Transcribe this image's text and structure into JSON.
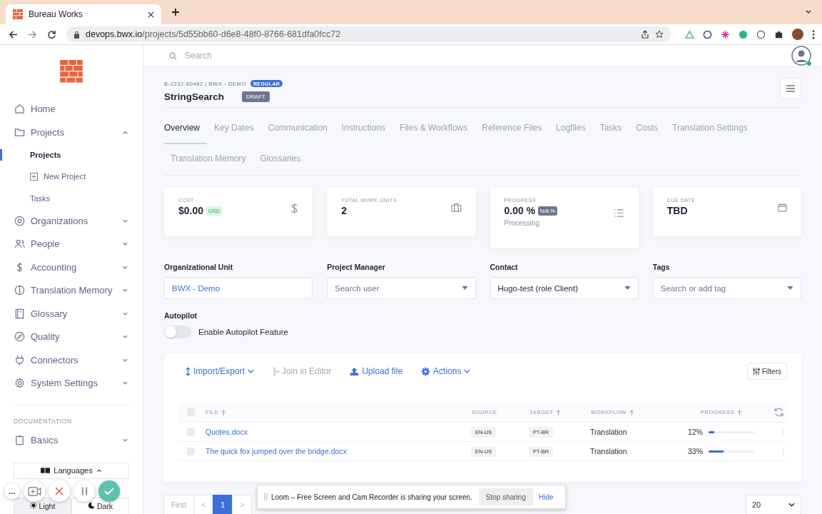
{
  "browser": {
    "tab_title": "Bureau Works",
    "url_host": "devops.bwx.io",
    "url_path": "/projects/5d55bb60-d6e8-48f0-8766-681dfa0fcc72"
  },
  "sidebar": {
    "items": [
      {
        "label": "Home",
        "kind": "link",
        "selected": false
      },
      {
        "label": "Projects",
        "kind": "group",
        "expanded": true,
        "selected": false,
        "children": [
          {
            "label": "Projects",
            "selected": true,
            "kind": "plain"
          },
          {
            "label": "New Project",
            "selected": false,
            "kind": "add"
          },
          {
            "label": "Tasks",
            "selected": false,
            "kind": "plain"
          }
        ]
      },
      {
        "label": "Organizations",
        "kind": "group",
        "expanded": false,
        "selected": false
      },
      {
        "label": "People",
        "kind": "group",
        "expanded": false,
        "selected": false
      },
      {
        "label": "Accounting",
        "kind": "group",
        "expanded": false,
        "selected": false
      },
      {
        "label": "Translation Memory",
        "kind": "group",
        "expanded": false,
        "selected": false
      },
      {
        "label": "Glossary",
        "kind": "group",
        "expanded": false,
        "selected": false
      },
      {
        "label": "Quality",
        "kind": "group",
        "expanded": false,
        "selected": false
      },
      {
        "label": "Connectors",
        "kind": "group",
        "expanded": false,
        "selected": false
      },
      {
        "label": "System Settings",
        "kind": "group",
        "expanded": false,
        "selected": false
      }
    ],
    "section_title": "DOCUMENTATION",
    "doc_items": [
      {
        "label": "Basics",
        "kind": "group",
        "expanded": false,
        "selected": false
      }
    ],
    "languages": {
      "label": "Languages",
      "expanded": true
    },
    "themes": [
      {
        "label": "Light",
        "selected": true
      },
      {
        "label": "Dark",
        "selected": false
      }
    ]
  },
  "search": {
    "placeholder": "Search"
  },
  "project": {
    "code": "B-2232-60462 | BWX - DEMO",
    "type_badge": "REGULAR",
    "title": "StringSearch",
    "status": "DRAFT"
  },
  "tabs": [
    {
      "label": "Overview",
      "selected": true
    },
    {
      "label": "Key Dates",
      "selected": false
    },
    {
      "label": "Communication",
      "selected": false
    },
    {
      "label": "Instructions",
      "selected": false
    },
    {
      "label": "Files & Workflows",
      "selected": false
    },
    {
      "label": "Reference Files",
      "selected": false
    },
    {
      "label": "Logfiles",
      "selected": false
    },
    {
      "label": "Tasks",
      "selected": false
    },
    {
      "label": "Costs",
      "selected": false
    },
    {
      "label": "Translation Settings",
      "selected": false
    },
    {
      "label": "Translation Memory",
      "selected": false
    },
    {
      "label": "Glossaries",
      "selected": false
    }
  ],
  "stats": [
    {
      "label": "COST",
      "value": "$0.00",
      "badge": {
        "text": "USD",
        "kind": "success"
      },
      "kind": "cost"
    },
    {
      "label": "TOTAL WORK UNITS",
      "value": "2",
      "kind": "units"
    },
    {
      "label": "PROGRESS",
      "value": "0.00 %",
      "badge": {
        "text": "N/A %",
        "kind": "neutral"
      },
      "note": "Processing",
      "kind": "progress"
    },
    {
      "label": "DUE DATE",
      "value": "TBD",
      "kind": "date"
    }
  ],
  "fields": [
    {
      "label": "Organizational Unit",
      "kind": "text",
      "value": "BWX - Demo"
    },
    {
      "label": "Project Manager",
      "kind": "select",
      "placeholder": "Search user"
    },
    {
      "label": "Contact",
      "kind": "select",
      "value": "Hugo-test (role Client)"
    },
    {
      "label": "Tags",
      "kind": "select",
      "placeholder": "Search or add tag"
    }
  ],
  "autopilot": {
    "label": "Autopilot",
    "toggle_label": "Enable Autopilot Feature",
    "on": false
  },
  "files": {
    "actions": [
      {
        "label": "Import/Export",
        "kind": "updown",
        "menu": true,
        "disabled": false
      },
      {
        "label": "Join in Editor",
        "kind": "branch",
        "menu": false,
        "disabled": true
      },
      {
        "label": "Upload file",
        "kind": "upload",
        "menu": false,
        "disabled": false
      },
      {
        "label": "Actions",
        "kind": "gear",
        "menu": true,
        "disabled": false
      }
    ],
    "filters_label": "Filters",
    "columns": [
      {
        "label": "FILE",
        "sorted": true
      },
      {
        "label": "SOURCE",
        "sorted": false
      },
      {
        "label": "TARGET",
        "sorted": true
      },
      {
        "label": "WORKFLOW",
        "sorted": true
      },
      {
        "label": "PROGRESS",
        "sorted": true
      }
    ],
    "header_checked": false,
    "rows": [
      {
        "checked": false,
        "file": "Quotes.docx",
        "source": "EN-US",
        "target": "PT-BR",
        "workflow": "Translation",
        "progress": "12%",
        "level": 0.12
      },
      {
        "checked": false,
        "file": "The quick fox jumped over the bridge.docx",
        "source": "EN-US",
        "target": "PT-BR",
        "workflow": "Translation",
        "progress": "33%",
        "level": 0.33
      }
    ]
  },
  "pagination": {
    "pages": [
      {
        "label": "First",
        "kind": "first",
        "selected": false
      },
      {
        "label": "<",
        "kind": "prev",
        "selected": false
      },
      {
        "label": "1",
        "kind": "page",
        "selected": true
      },
      {
        "label": ">",
        "kind": "next",
        "selected": false
      }
    ],
    "page_size": "20"
  },
  "loom": {
    "message": "Loom – Free Screen and Cam Recorder is sharing your screen.",
    "stop": "Stop sharing",
    "hide": "Hide",
    "more": "..."
  }
}
